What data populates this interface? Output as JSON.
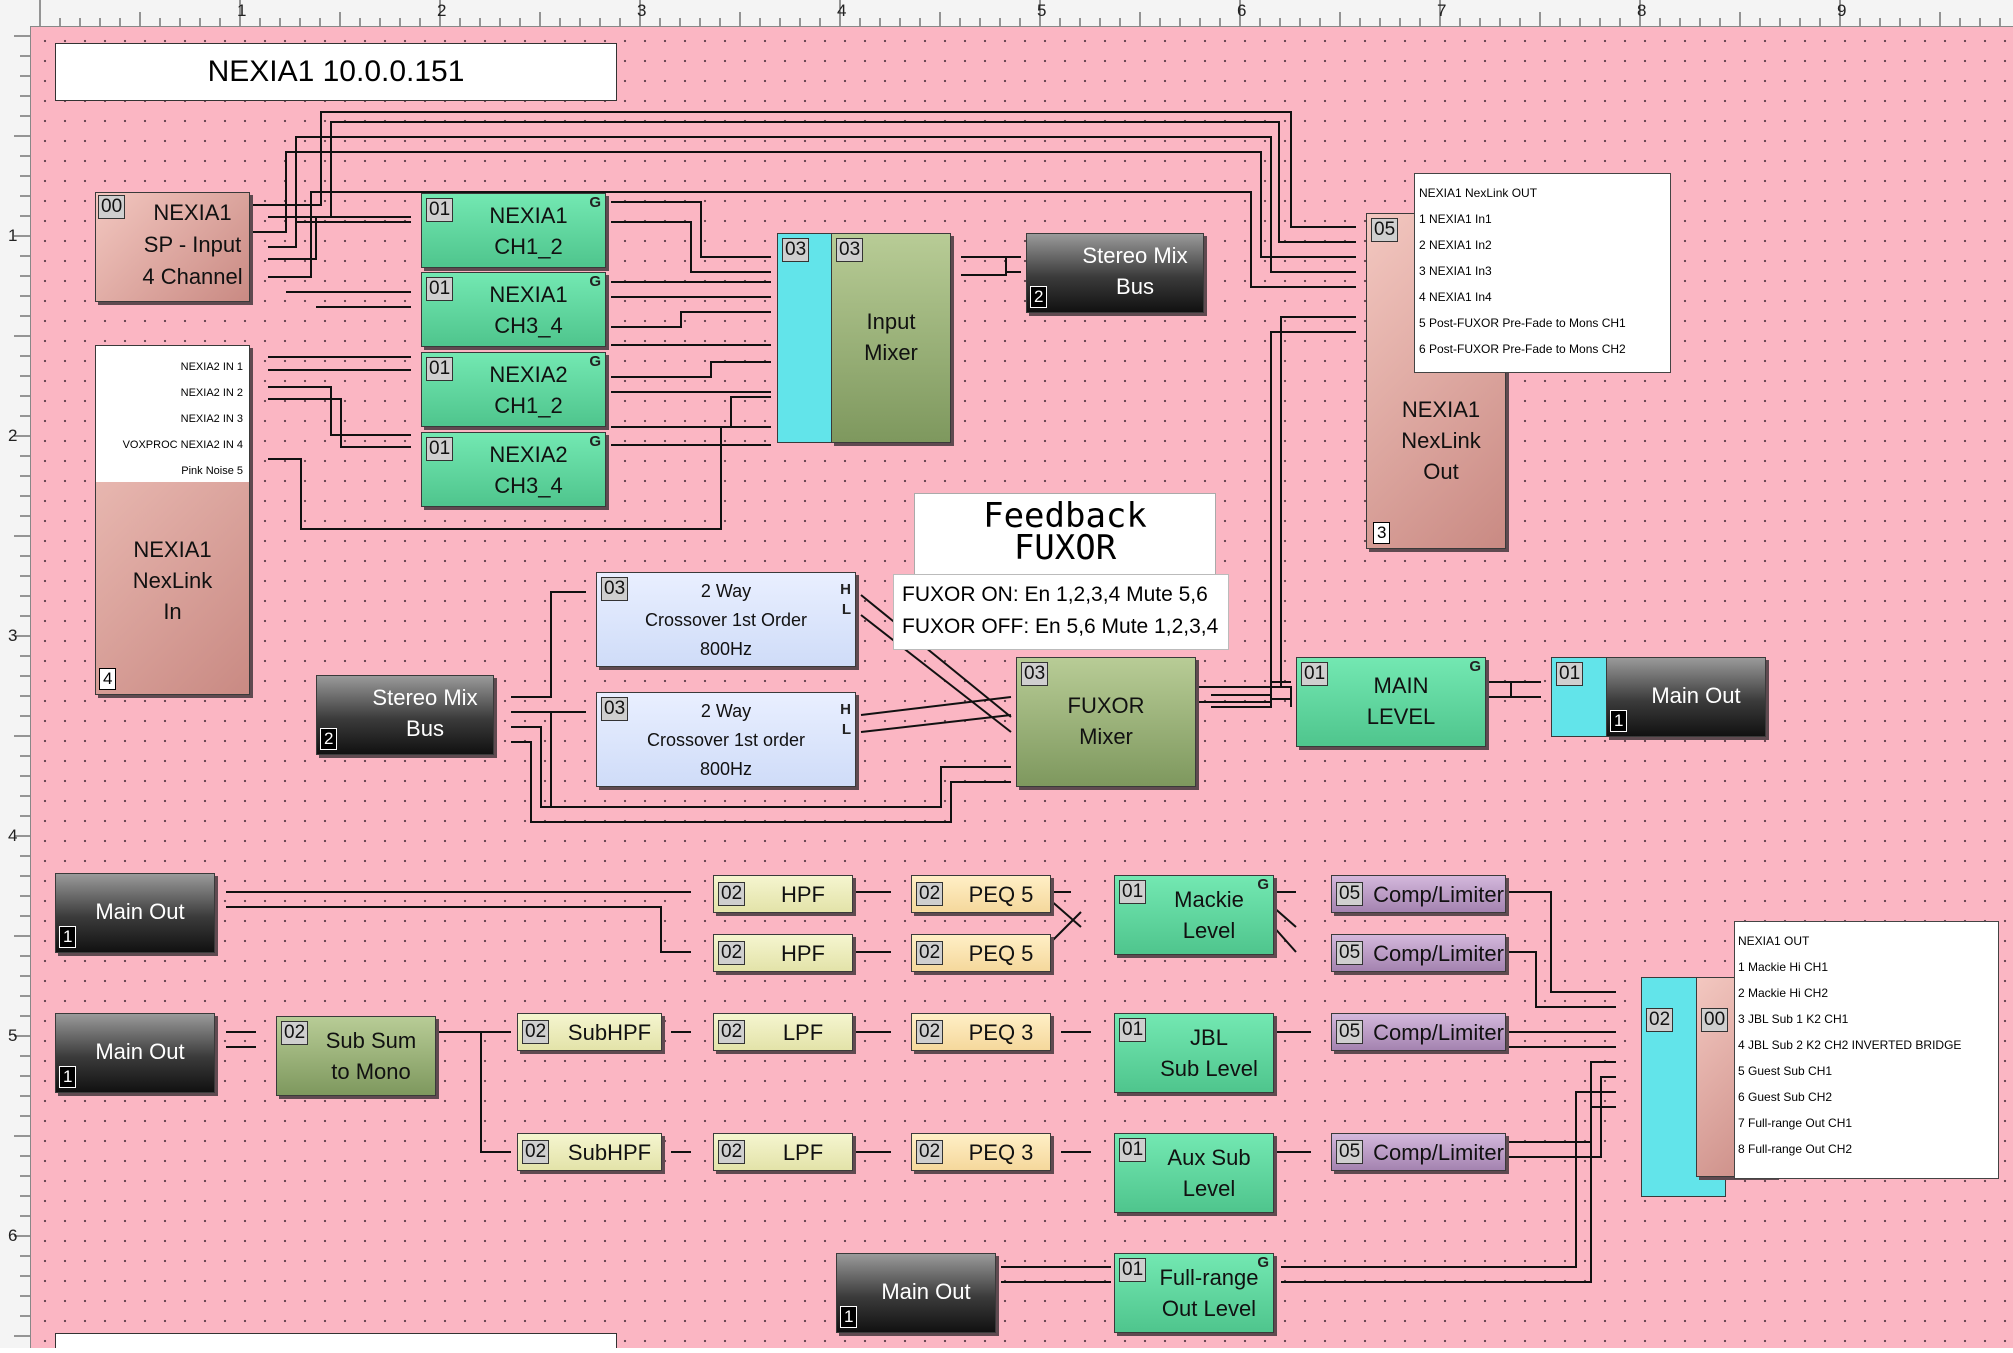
{
  "ruler": {
    "top_numbers": [
      "1",
      "2",
      "3",
      "4",
      "5",
      "6",
      "7",
      "8",
      "9"
    ],
    "left_numbers": [
      "1",
      "2",
      "3",
      "4",
      "5",
      "6"
    ]
  },
  "title": "NEXIA1 10.0.0.151",
  "feedback_title_line1": "Feedback",
  "feedback_title_line2": "FUXOR",
  "fuxor_note": [
    "FUXOR ON: En 1,2,3,4 Mute 5,6",
    "FUXOR OFF: En 5,6 Mute 1,2,3,4"
  ],
  "blocks": {
    "sp_input": {
      "badge": "00",
      "label": "NEXIA1\nSP - Input\n4 Channel"
    },
    "nexlink_in": {
      "label": "NEXIA1\nNexLink\nIn",
      "num": "4",
      "inputs": [
        "NEXIA2 IN 1",
        "NEXIA2 IN 2",
        "NEXIA2 IN 3",
        "VOXPROC NEXIA2 IN 4",
        "Pink Noise 5"
      ]
    },
    "ch1_2_a": {
      "badge": "01",
      "label": "NEXIA1\nCH1_2",
      "g": "G"
    },
    "ch3_4_a": {
      "badge": "01",
      "label": "NEXIA1\nCH3_4",
      "g": "G"
    },
    "ch1_2_b": {
      "badge": "01",
      "label": "NEXIA2\nCH1_2",
      "g": "G"
    },
    "ch3_4_b": {
      "badge": "01",
      "label": "NEXIA2\nCH3_4",
      "g": "G"
    },
    "input_mixer": {
      "badge_in": "03",
      "badge": "03",
      "label": "Input\nMixer"
    },
    "stereo_mix_bus_top": {
      "label": "Stereo Mix\nBus",
      "num": "2"
    },
    "nexlink_out": {
      "badge": "05",
      "label": "NEXIA1\nNexLink\nOut",
      "num": "3",
      "outputs": [
        "NEXIA1 NexLink OUT",
        "1 NEXIA1 In1",
        "2 NEXIA1 In2",
        "3 NEXIA1 In3",
        "4 NEXIA1 In4",
        "5 Post-FUXOR Pre-Fade to Mons CH1",
        "6 Post-FUXOR Pre-Fade to Mons CH2"
      ]
    },
    "crossover_1": {
      "badge": "03",
      "label": "2 Way\nCrossover 1st Order\n800Hz",
      "h": "H",
      "l": "L"
    },
    "crossover_2": {
      "badge": "03",
      "label": "2 Way\nCrossover 1st order\n800Hz",
      "h": "H",
      "l": "L"
    },
    "stereo_mix_bus_mid": {
      "label": "Stereo Mix\nBus",
      "num": "2"
    },
    "fuxor_mixer": {
      "badge": "03",
      "label": "FUXOR\nMixer"
    },
    "main_level": {
      "badge": "01",
      "label": "MAIN\nLEVEL",
      "g": "G"
    },
    "main_out_top": {
      "badge": "01",
      "label": "Main Out",
      "num": "1"
    },
    "main_out_1": {
      "label": "Main Out",
      "num": "1"
    },
    "hpf_1": {
      "badge": "02",
      "label": "HPF"
    },
    "hpf_2": {
      "badge": "02",
      "label": "HPF"
    },
    "peq5_1": {
      "badge": "02",
      "label": "PEQ 5"
    },
    "peq5_2": {
      "badge": "02",
      "label": "PEQ 5"
    },
    "mackie_level": {
      "badge": "01",
      "label": "Mackie\nLevel",
      "g": "G"
    },
    "comp_1": {
      "badge": "05",
      "label": "Comp/Limiter"
    },
    "comp_2": {
      "badge": "05",
      "label": "Comp/Limiter"
    },
    "main_out_2": {
      "label": "Main Out",
      "num": "1"
    },
    "sub_sum": {
      "badge": "02",
      "label": "Sub Sum\nto Mono"
    },
    "subhpf_1": {
      "badge": "02",
      "label": "SubHPF"
    },
    "lpf_1": {
      "badge": "02",
      "label": "LPF"
    },
    "peq3_1": {
      "badge": "02",
      "label": "PEQ 3"
    },
    "jbl_level": {
      "badge": "01",
      "label": "JBL\nSub Level"
    },
    "comp_3": {
      "badge": "05",
      "label": "Comp/Limiter"
    },
    "subhpf_2": {
      "badge": "02",
      "label": "SubHPF"
    },
    "lpf_2": {
      "badge": "02",
      "label": "LPF"
    },
    "peq3_2": {
      "badge": "02",
      "label": "PEQ 3"
    },
    "aux_sub": {
      "badge": "01",
      "label": "Aux Sub\nLevel"
    },
    "comp_4": {
      "badge": "05",
      "label": "Comp/Limiter"
    },
    "nexia_out": {
      "badge_in": "02",
      "badge": "00",
      "outputs": [
        "NEXIA1 OUT",
        "1 Mackie Hi CH1",
        "2 Mackie Hi CH2",
        "3 JBL Sub 1 K2 CH1",
        "4 JBL Sub 2 K2 CH2 INVERTED BRIDGE",
        "5 Guest Sub CH1",
        "6 Guest Sub CH2",
        "7 Full-range Out CH1",
        "8 Full-range Out CH2"
      ]
    },
    "main_out_3": {
      "label": "Main Out",
      "num": "1"
    },
    "fullrange_level": {
      "badge": "01",
      "label": "Full-range\nOut Level",
      "g": "G"
    }
  }
}
